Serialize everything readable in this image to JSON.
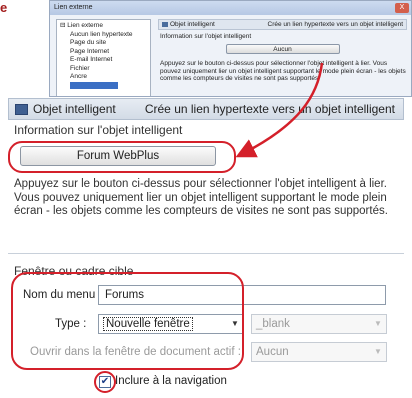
{
  "corner_letter": "e",
  "mini": {
    "title": "Lien externe",
    "close": "X",
    "tree": [
      "Lien externe",
      "Aucun lien hypertexte",
      "Page du site",
      "Page Internet",
      "E-mail Internet",
      "Fichier",
      "Ancre"
    ],
    "header_left": "Objet intelligent",
    "header_right": "Crée un lien hypertexte vers un objet intelligent",
    "info": "Information sur l'objet intelligent",
    "button": "Aucun",
    "desc": "Appuyez sur le bouton ci-dessus pour sélectionner l'objet intelligent à lier. Vous pouvez uniquement lier un objet intelligent supportant le mode plein écran - les objets comme les compteurs de visites ne sont pas supportés."
  },
  "panel": {
    "header_left": "Objet intelligent",
    "header_right": "Crée un lien hypertexte vers un objet intelligent",
    "info_label": "Information sur l'objet intelligent",
    "button": "Forum WebPlus",
    "desc": "Appuyez sur le bouton ci-dessus pour sélectionner l'objet intelligent à lier. Vous pouvez uniquement lier un objet intelligent supportant le mode plein écran - les objets comme les compteurs de visites ne sont pas supportés."
  },
  "target": {
    "section_label": "Fenêtre ou cadre cible",
    "menu_label": "Nom du menu :",
    "menu_value": "Forums",
    "type_label": "Type :",
    "type_value": "Nouvelle fenêtre",
    "blank_value": "_blank",
    "open_label": "Ouvrir dans la fenêtre de document actif :",
    "open_value": "Aucun"
  },
  "nav": {
    "checked": true,
    "label": "Inclure à la navigation"
  },
  "colors": {
    "annotation": "#d4202a"
  }
}
